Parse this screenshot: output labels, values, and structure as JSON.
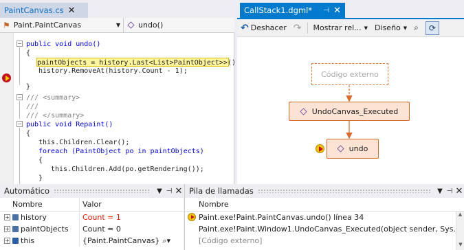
{
  "tabs": {
    "code": {
      "label": "PaintCanvas.cs",
      "close": "✕"
    },
    "dgml": {
      "label": "CallStack1.dgml*",
      "pin": "⊣",
      "close": "✕"
    }
  },
  "nav": {
    "class_name": "Paint.PaintCanvas",
    "method_name": "undo()"
  },
  "code_lines": [
    "public void undo()",
    "{",
    "paintObjects = history.Last<List>PaintObject>>();",
    "history.RemoveAt(history.Count - 1);",
    "",
    "}",
    "",
    "/// <summary>",
    "///",
    "/// </summary>",
    "public void Repaint()",
    "{",
    "this.Children.Clear();",
    "foreach (PaintObject po in paintObjects)",
    "{",
    "this.Children.Add(po.getRendering());",
    "}"
  ],
  "dgml_toolbar": {
    "undo_label": "Deshacer",
    "show_label": "Mostrar rel...",
    "layout_label": "Diseño"
  },
  "graph": {
    "external_node": "Código externo",
    "undocanvas_node": "UndoCanvas_Executed",
    "undo_node": "undo",
    "node_color": "#fde3d3",
    "edge_color": "#d96a2b"
  },
  "autos": {
    "title": "Automático",
    "col_name": "Nombre",
    "col_value": "Valor",
    "rows": [
      {
        "name": "history",
        "value": "Count = 1"
      },
      {
        "name": "paintObjects",
        "value": "Count = 0"
      },
      {
        "name": "this",
        "value": "{Paint.PaintCanvas}"
      }
    ]
  },
  "callstack": {
    "title": "Pila de llamadas",
    "col_name": "Nombre",
    "rows": [
      "Paint.exe!Paint.PaintCanvas.undo() línea 34",
      "Paint.exe!Paint.Window1.UndoCanvas_Executed(object sender, Sys...",
      "[Código externo]"
    ]
  }
}
